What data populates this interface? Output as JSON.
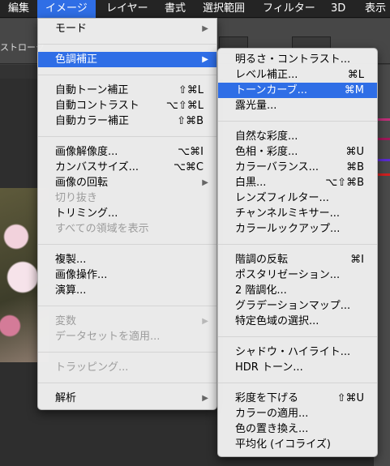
{
  "menubar": {
    "items": [
      {
        "label": "編集"
      },
      {
        "label": "イメージ"
      },
      {
        "label": "レイヤー"
      },
      {
        "label": "書式"
      },
      {
        "label": "選択範囲"
      },
      {
        "label": "フィルター"
      },
      {
        "label": "3D"
      },
      {
        "label": "表示"
      }
    ]
  },
  "options": {
    "stroke_label": "ストローク"
  },
  "image_menu": {
    "items": [
      {
        "label": "モード",
        "submenu": true
      },
      {
        "label": "色調補正",
        "submenu": true,
        "highlighted": true
      },
      {
        "label": "自動トーン補正",
        "shortcut": "⇧⌘L"
      },
      {
        "label": "自動コントラスト",
        "shortcut": "⌥⇧⌘L"
      },
      {
        "label": "自動カラー補正",
        "shortcut": "⇧⌘B"
      },
      {
        "label": "画像解像度...",
        "shortcut": "⌥⌘I"
      },
      {
        "label": "カンバスサイズ...",
        "shortcut": "⌥⌘C"
      },
      {
        "label": "画像の回転",
        "submenu": true
      },
      {
        "label": "切り抜き",
        "disabled": true
      },
      {
        "label": "トリミング..."
      },
      {
        "label": "すべての領域を表示",
        "disabled": true
      },
      {
        "label": "複製..."
      },
      {
        "label": "画像操作..."
      },
      {
        "label": "演算..."
      },
      {
        "label": "変数",
        "submenu": true,
        "disabled": true
      },
      {
        "label": "データセットを適用...",
        "disabled": true
      },
      {
        "label": "トラッピング...",
        "disabled": true
      },
      {
        "label": "解析",
        "submenu": true
      }
    ]
  },
  "adjust_menu": {
    "items": [
      {
        "label": "明るさ・コントラスト..."
      },
      {
        "label": "レベル補正...",
        "shortcut": "⌘L"
      },
      {
        "label": "トーンカーブ...",
        "shortcut": "⌘M",
        "highlighted": true
      },
      {
        "label": "露光量..."
      },
      {
        "label": "自然な彩度..."
      },
      {
        "label": "色相・彩度...",
        "shortcut": "⌘U"
      },
      {
        "label": "カラーバランス...",
        "shortcut": "⌘B"
      },
      {
        "label": "白黒...",
        "shortcut": "⌥⇧⌘B"
      },
      {
        "label": "レンズフィルター..."
      },
      {
        "label": "チャンネルミキサー..."
      },
      {
        "label": "カラールックアップ..."
      },
      {
        "label": "階調の反転",
        "shortcut": "⌘I"
      },
      {
        "label": "ポスタリゼーション..."
      },
      {
        "label": "2 階調化..."
      },
      {
        "label": "グラデーションマップ..."
      },
      {
        "label": "特定色域の選択..."
      },
      {
        "label": "シャドウ・ハイライト..."
      },
      {
        "label": "HDR トーン..."
      },
      {
        "label": "彩度を下げる",
        "shortcut": "⇧⌘U"
      },
      {
        "label": "カラーの適用..."
      },
      {
        "label": "色の置き換え..."
      },
      {
        "label": "平均化 (イコライズ)"
      }
    ]
  },
  "colors": {
    "highlight": "#2f6ee6",
    "menu_bg": "#eeeeee",
    "disabled_text": "#9c9c9c",
    "swatches": [
      "#c0307a",
      "#a01858",
      "#5a2ccf",
      "#d02020"
    ]
  }
}
